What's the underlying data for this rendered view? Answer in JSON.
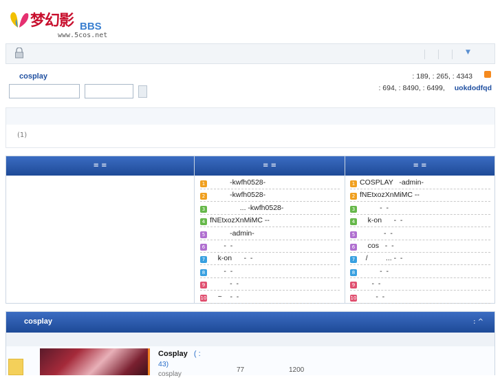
{
  "header": {
    "logo_text": "梦幻影",
    "logo_suffix": "BBS",
    "site_url": "www.5cos.net"
  },
  "user": {
    "name": "cosplay"
  },
  "stats": {
    "line1": ": 189,  : 265,  : 4343",
    "line2": ": 694,  : 8490,  : 6499,",
    "newest_member": "uokdodfqd"
  },
  "notice": {
    "count": "(1)"
  },
  "table": {
    "headers": [
      "≡    ≡",
      "≡    ≡",
      "≡    ≡"
    ],
    "middle": [
      "          -kwfh0528-",
      "          -kwfh0528-",
      "               ... -kwfh0528-",
      "fNEtxozXnMiMC --",
      "          -admin-",
      "       -  -",
      "    k-on      -  -",
      "       -  -",
      "          -  -",
      "    ~    -  -"
    ],
    "right": [
      "COSPLAY   -admin-",
      "fNEtxozXnMiMC --",
      "          -  -",
      "    k-on      -  -",
      "            -  -",
      "    cos   -  -",
      "   /         ... -  -",
      "          -  -",
      "      -  -",
      "        -  -"
    ],
    "rank_colors": [
      "#f0a020",
      "#f0a020",
      "#66b84a",
      "#66b84a",
      "#b070d0",
      "#b070d0",
      "#38a0e0",
      "#38a0e0",
      "#e05070",
      "#e05070"
    ]
  },
  "forum": {
    "title": "cosplay",
    "controls": ":  ^",
    "name": "Cosplay",
    "count_open": "( :",
    "count": "43)",
    "n1": "77",
    "n2": "1200",
    "sub": "cosplay"
  }
}
